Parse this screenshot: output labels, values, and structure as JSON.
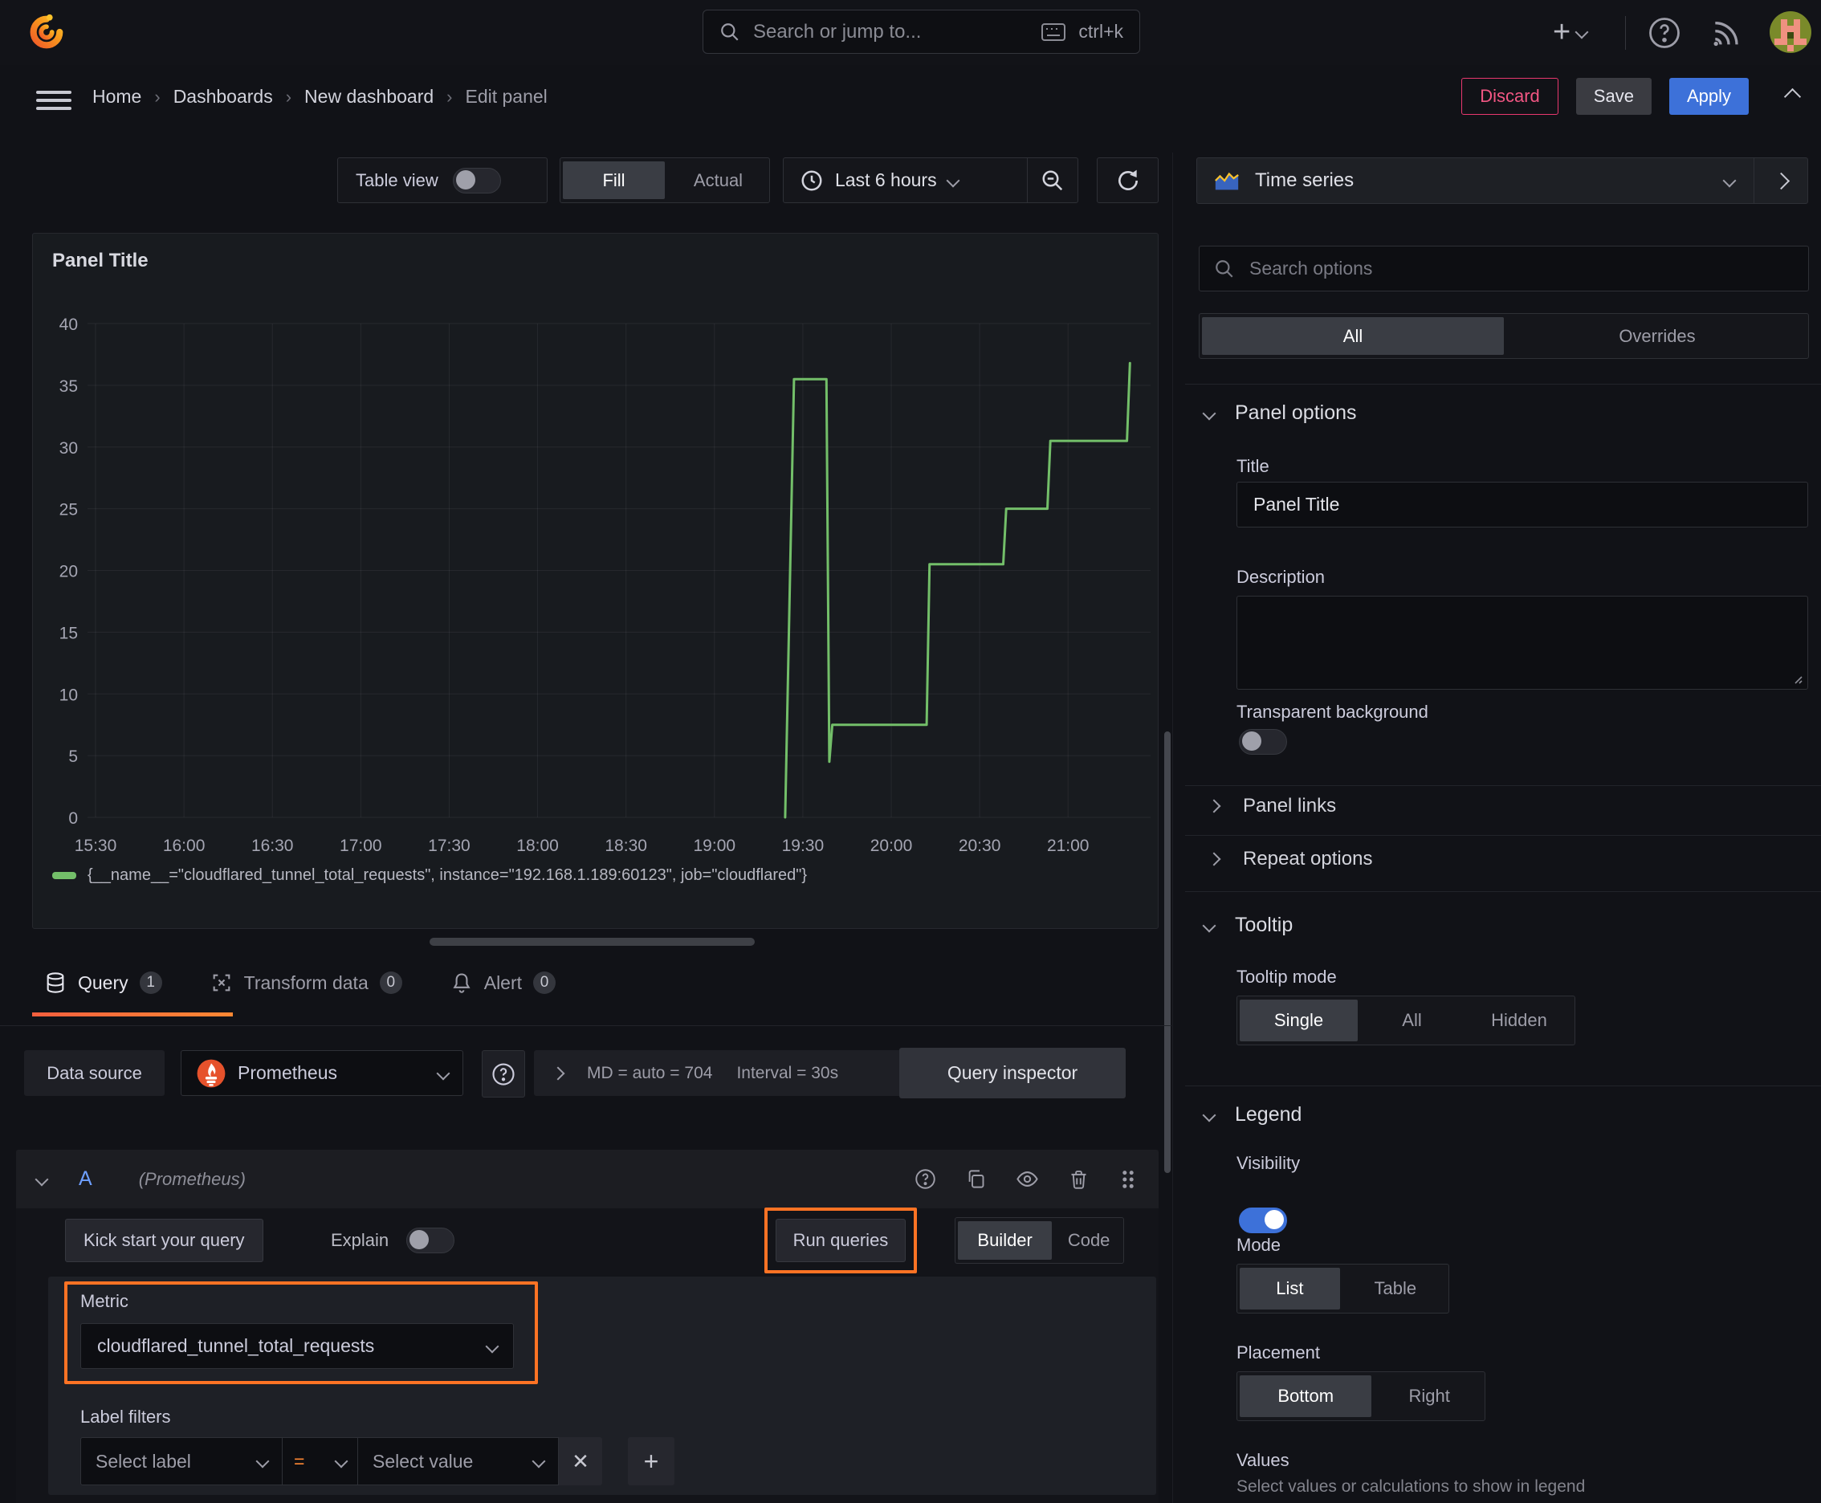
{
  "colors": {
    "accent_blue": "#3d71d9",
    "highlight_orange": "#ff7324",
    "series_green": "#73bf69",
    "danger_pink": "#f25683"
  },
  "topbar": {
    "search_placeholder": "Search or jump to...",
    "search_shortcut": "ctrl+k"
  },
  "breadcrumb": {
    "items": [
      {
        "label": "Home"
      },
      {
        "label": "Dashboards"
      },
      {
        "label": "New dashboard"
      },
      {
        "label": "Edit panel"
      }
    ],
    "discard_label": "Discard",
    "save_label": "Save",
    "apply_label": "Apply"
  },
  "toolbar": {
    "table_view_label": "Table view",
    "fill_label": "Fill",
    "actual_label": "Actual",
    "time_range_label": "Last 6 hours"
  },
  "panel": {
    "title": "Panel Title"
  },
  "chart_data": {
    "type": "line",
    "line_style": "step",
    "title": "Panel Title",
    "x_ticks": [
      "15:30",
      "16:00",
      "16:30",
      "17:00",
      "17:30",
      "18:00",
      "18:30",
      "19:00",
      "19:30",
      "20:00",
      "20:30",
      "21:00"
    ],
    "y_ticks": [
      0,
      5,
      10,
      15,
      20,
      25,
      30,
      35,
      40
    ],
    "ylim": [
      0,
      40
    ],
    "x_range": [
      "15:26",
      "21:28"
    ],
    "grid": true,
    "legend_position": "bottom",
    "series": [
      {
        "name": "{__name__=\"cloudflared_tunnel_total_requests\", instance=\"192.168.1.189:60123\", job=\"cloudflared\"}",
        "color": "#73bf69",
        "points": [
          [
            "19:24",
            0
          ],
          [
            "19:27",
            35.5
          ],
          [
            "19:38",
            35.5
          ],
          [
            "19:39",
            4.5
          ],
          [
            "19:40",
            7.5
          ],
          [
            "20:12",
            7.5
          ],
          [
            "20:13",
            20.5
          ],
          [
            "20:38",
            20.5
          ],
          [
            "20:39",
            25
          ],
          [
            "20:53",
            25
          ],
          [
            "20:54",
            30.5
          ],
          [
            "21:20",
            30.5
          ],
          [
            "21:21",
            36.8
          ]
        ]
      }
    ]
  },
  "tabs": {
    "query": {
      "label": "Query",
      "count": "1"
    },
    "transform": {
      "label": "Transform data",
      "count": "0"
    },
    "alert": {
      "label": "Alert",
      "count": "0"
    }
  },
  "datasource_row": {
    "label": "Data source",
    "value": "Prometheus",
    "max_data_points": "MD = auto = 704",
    "interval": "Interval = 30s",
    "inspector_label": "Query inspector"
  },
  "query_editor": {
    "ref_id": "A",
    "ds_hint": "(Prometheus)",
    "kickstart_label": "Kick start your query",
    "explain_label": "Explain",
    "run_label": "Run queries",
    "builder_label": "Builder",
    "code_label": "Code",
    "metric_label": "Metric",
    "metric_value": "cloudflared_tunnel_total_requests",
    "label_filters_label": "Label filters",
    "select_label_placeholder": "Select label",
    "operator": "=",
    "select_value_placeholder": "Select value"
  },
  "sidebar": {
    "visualization": "Time series",
    "search_placeholder": "Search options",
    "filter_tabs": {
      "all": "All",
      "overrides": "Overrides"
    },
    "panel_options": {
      "title": "Panel options",
      "title_label": "Title",
      "title_value": "Panel Title",
      "description_label": "Description",
      "transparent_label": "Transparent background"
    },
    "panel_links_label": "Panel links",
    "repeat_options_label": "Repeat options",
    "tooltip": {
      "title": "Tooltip",
      "mode_label": "Tooltip mode",
      "modes": [
        "Single",
        "All",
        "Hidden"
      ],
      "selected_mode": "Single"
    },
    "legend": {
      "title": "Legend",
      "visibility_label": "Visibility",
      "mode_label": "Mode",
      "modes": [
        "List",
        "Table"
      ],
      "selected_mode": "List",
      "placement_label": "Placement",
      "placements": [
        "Bottom",
        "Right"
      ],
      "selected_placement": "Bottom",
      "values_label": "Values",
      "values_hint": "Select values or calculations to show in legend"
    }
  }
}
